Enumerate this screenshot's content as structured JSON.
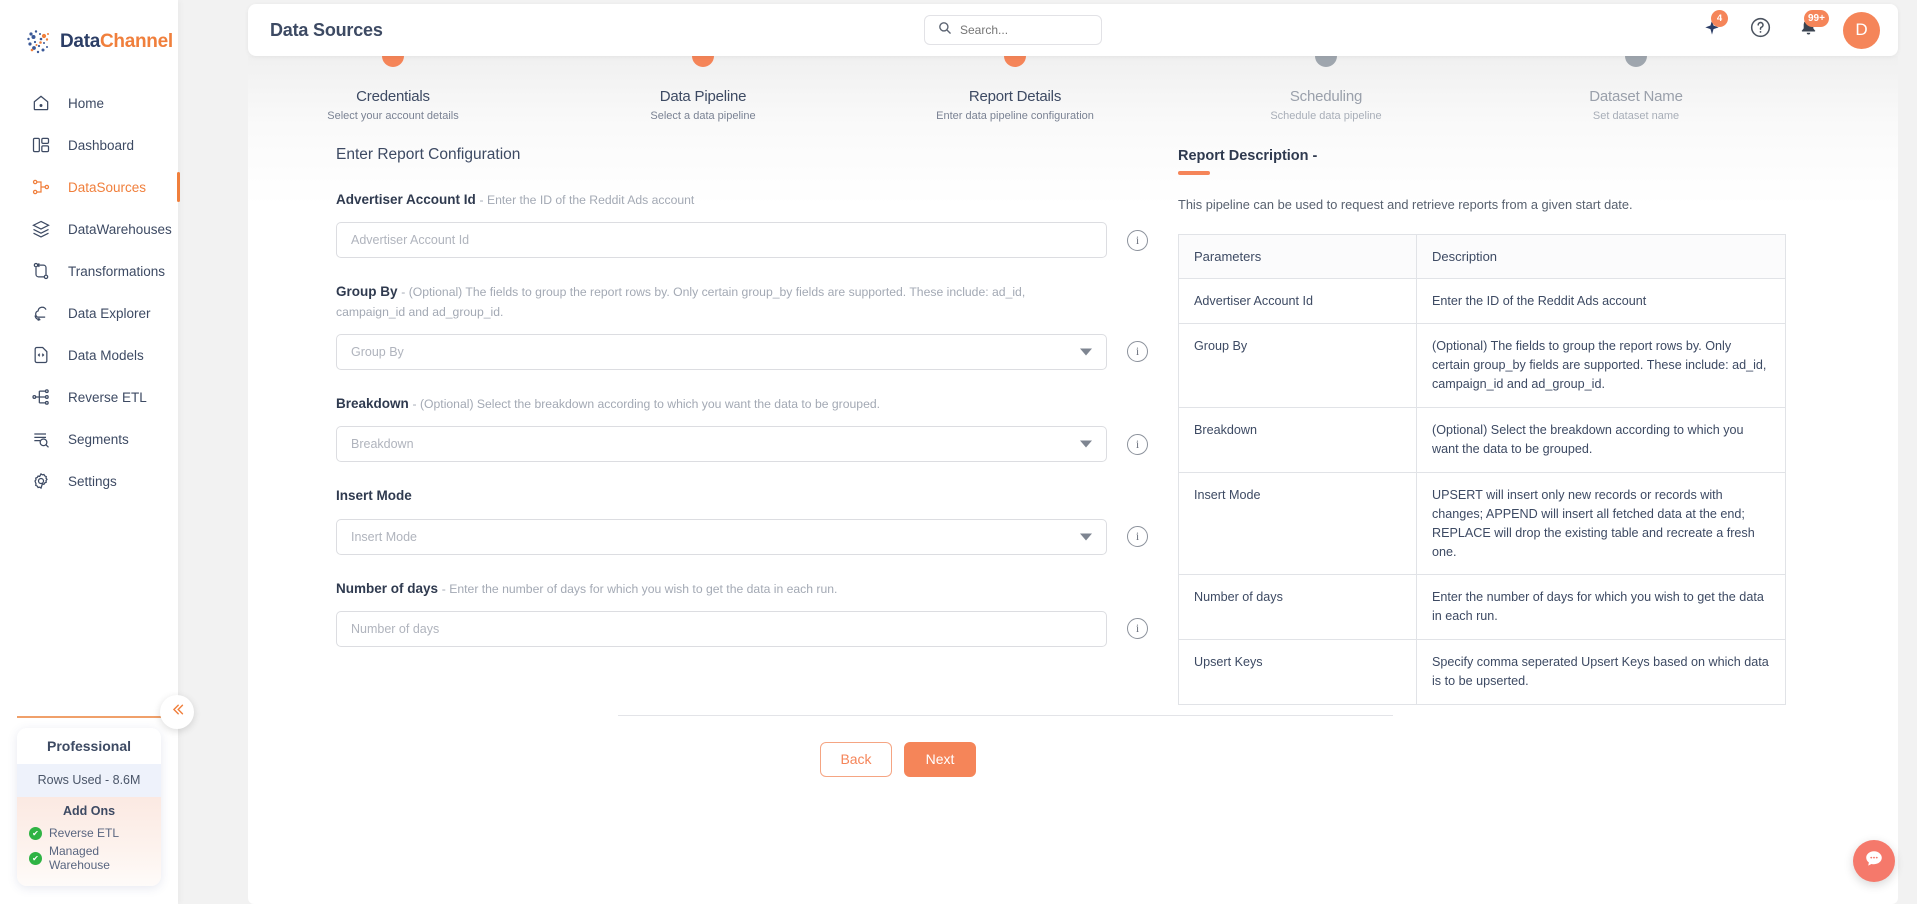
{
  "brand": {
    "part1": "Data",
    "part2": "Channel",
    "logo_icon": "datachannel-logo-icon"
  },
  "sidebar": {
    "items": [
      {
        "label": "Home",
        "icon": "home-icon",
        "active": false
      },
      {
        "label": "Dashboard",
        "icon": "dashboard-icon",
        "active": false
      },
      {
        "label": "DataSources",
        "icon": "datasources-icon",
        "active": true
      },
      {
        "label": "DataWarehouses",
        "icon": "datawarehouses-icon",
        "active": false
      },
      {
        "label": "Transformations",
        "icon": "transformations-icon",
        "active": false
      },
      {
        "label": "Data Explorer",
        "icon": "data-explorer-icon",
        "active": false
      },
      {
        "label": "Data Models",
        "icon": "data-models-icon",
        "active": false
      },
      {
        "label": "Reverse ETL",
        "icon": "reverse-etl-icon",
        "active": false
      },
      {
        "label": "Segments",
        "icon": "segments-icon",
        "active": false
      },
      {
        "label": "Settings",
        "icon": "gear-icon",
        "active": false
      }
    ],
    "plan": {
      "name": "Professional",
      "rows_used": "Rows Used - 8.6M",
      "addons_title": "Add Ons",
      "addons": [
        {
          "label": "Reverse ETL"
        },
        {
          "label": "Managed Warehouse"
        }
      ]
    },
    "collapse_icon": "collapse-chevrons-icon"
  },
  "header": {
    "title": "Data Sources",
    "search": {
      "placeholder": "Search...",
      "value": "",
      "icon": "search-icon"
    },
    "sparkle": {
      "icon": "sparkle-icon",
      "badge": "4"
    },
    "help": {
      "icon": "question-circle-icon"
    },
    "notifications": {
      "icon": "bell-icon",
      "badge": "99+"
    },
    "avatar": {
      "initial": "D"
    }
  },
  "stepper": {
    "steps": [
      {
        "title": "Credentials",
        "subtitle": "Select your account details",
        "state": "done"
      },
      {
        "title": "Data Pipeline",
        "subtitle": "Select a data pipeline",
        "state": "done"
      },
      {
        "title": "Report Details",
        "subtitle": "Enter data pipeline configuration",
        "state": "active"
      },
      {
        "title": "Scheduling",
        "subtitle": "Schedule data pipeline",
        "state": "pending"
      },
      {
        "title": "Dataset Name",
        "subtitle": "Set dataset name",
        "state": "pending"
      }
    ]
  },
  "form": {
    "title": "Enter Report Configuration",
    "fields": [
      {
        "label": "Advertiser Account Id",
        "hint": "- Enter the ID of the Reddit Ads account",
        "type": "text",
        "placeholder": "Advertiser Account Id",
        "value": ""
      },
      {
        "label": "Group By",
        "hint": "- (Optional) The fields to group the report rows by. Only certain group_by fields are supported. These include: ad_id, campaign_id and ad_group_id.",
        "type": "select",
        "placeholder": "Group By",
        "value": ""
      },
      {
        "label": "Breakdown",
        "hint": "- (Optional) Select the breakdown according to which you want the data to be grouped.",
        "type": "select",
        "placeholder": "Breakdown",
        "value": ""
      },
      {
        "label": "Insert Mode",
        "hint": "",
        "type": "select",
        "placeholder": "Insert Mode",
        "value": ""
      },
      {
        "label": "Number of days",
        "hint": "- Enter the number of days for which you wish to get the data in each run.",
        "type": "text",
        "placeholder": "Number of days",
        "value": ""
      }
    ],
    "back_label": "Back",
    "next_label": "Next"
  },
  "report_description": {
    "title": "Report Description -",
    "intro": "This pipeline can be used to request and retrieve reports from a given start date.",
    "columns": [
      "Parameters",
      "Description"
    ],
    "rows": [
      {
        "parameter": "Advertiser Account Id",
        "description": "Enter the ID of the Reddit Ads account"
      },
      {
        "parameter": "Group By",
        "description": "(Optional) The fields to group the report rows by. Only certain group_by fields are supported. These include: ad_id, campaign_id and ad_group_id."
      },
      {
        "parameter": "Breakdown",
        "description": "(Optional) Select the breakdown according to which you want the data to be grouped."
      },
      {
        "parameter": "Insert Mode",
        "description": "UPSERT will insert only new records or records with changes; APPEND will insert all fetched data at the end; REPLACE will drop the existing table and recreate a fresh one."
      },
      {
        "parameter": "Number of days",
        "description": "Enter the number of days for which you wish to get the data in each run."
      },
      {
        "parameter": "Upsert Keys",
        "description": "Specify comma seperated Upsert Keys based on which data is to be upserted."
      }
    ]
  },
  "chat": {
    "icon": "chat-bubble-icon"
  },
  "colors": {
    "accent": "#f58559",
    "accent_dark": "#f07f3c",
    "brand_navy": "#2c3e66",
    "pending_grey": "#9fa6ae",
    "success_green": "#2fb344"
  }
}
